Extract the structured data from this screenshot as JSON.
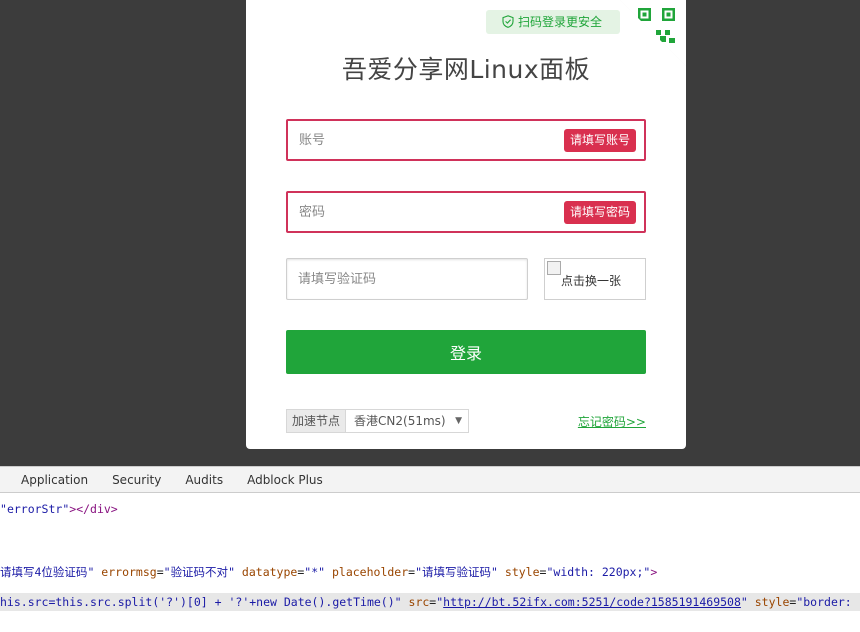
{
  "login": {
    "qr_tip": "扫码登录更安全",
    "title": "吾爱分享网Linux面板",
    "username": {
      "placeholder": "账号",
      "error": "请填写账号"
    },
    "password": {
      "placeholder": "密码",
      "error": "请填写密码"
    },
    "captcha_input": {
      "placeholder": "请填写验证码"
    },
    "captcha_image_alt": "点击换一张",
    "login_button": "登录",
    "node": {
      "label": "加速节点",
      "value": "香港CN2(51ms)"
    },
    "forgot": "忘记密码>>",
    "accent_color": "#20a53a",
    "error_color": "#d9304f"
  },
  "devtools": {
    "tabs": [
      "Application",
      "Security",
      "Audits",
      "Adblock Plus"
    ],
    "line1": {
      "attr_value": "errorStr",
      "tag_close": "></div>"
    },
    "line2": {
      "v1": "请填写4位验证码",
      "a2": "errormsg",
      "v2": "验证码不对",
      "a3": "datatype",
      "v3": "*",
      "a4": "placeholder",
      "v4": "请填写验证码",
      "a5": "style",
      "v5": "width: 220px;"
    },
    "line3": {
      "v1": "his.src=this.src.split('?')[0] + '?'+new Date().getTime()",
      "a2": "src",
      "v2": "http://bt.52ifx.com:5251/code?1585191469508",
      "a3": "style",
      "v3": "border:"
    }
  }
}
